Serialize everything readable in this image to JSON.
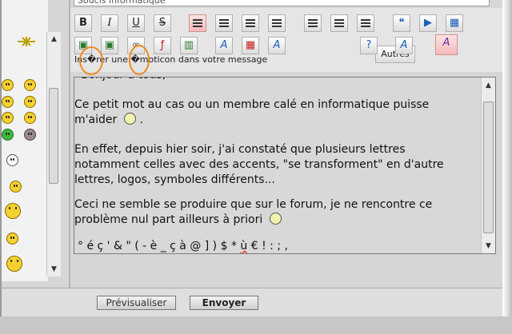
{
  "subject": {
    "value": "Soucis informatique"
  },
  "toolbar": {
    "bold_label": "B",
    "italic_label": "I",
    "underline_label": "U",
    "strike_label": "S",
    "autres_label": "Autres",
    "hint": "Ins�rer une �moticon dans votre message",
    "row1_icons": [
      "bold-icon",
      "italic-icon",
      "underline-icon",
      "strikethrough-icon",
      "align-left-icon",
      "align-center-icon",
      "align-right-icon",
      "justify-icon",
      "bulleted-list-icon",
      "numbered-list-icon",
      "horizontal-rule-icon",
      "quote-icon",
      "spoiler-icon",
      "table-icon"
    ],
    "row2_icons": [
      "image-host-icon",
      "image-icon",
      "link-icon",
      "flash-icon",
      "video-icon",
      "font-icon",
      "color-icon",
      "font-size-icon",
      "help-icon",
      "clear-format-icon",
      "text-style-icon"
    ]
  },
  "message": {
    "line0": "Bonjour à tous,",
    "p1_line1": "Ce petit mot au cas ou un membre calé en informatique puisse",
    "p1_line2": "m'aider",
    "p1_end": ".",
    "p2_line1": "En effet, depuis hier soir, j'ai constaté que plusieurs lettres",
    "p2_line2": "notamment celles avec des accents, \"se transforment\" en d'autre",
    "p2_line3": "lettres, logos, symboles différents...",
    "p3_line1": "Ceci ne semble se produire que sur le forum, je ne rencontre ce",
    "p3_line2": "problème nul part ailleurs à priori",
    "p4_a": "° é ç ' & \" ( - è _ ç à @ ] ) $ * ",
    "p4_err": "ù",
    "p4_b": " € ! : ; ,"
  },
  "buttons": {
    "preview": "Prévisualiser",
    "send": "Envoyer"
  },
  "colors": {
    "highlight_circle": "#ef8a1e",
    "message_bg": "#d8d8d8"
  }
}
